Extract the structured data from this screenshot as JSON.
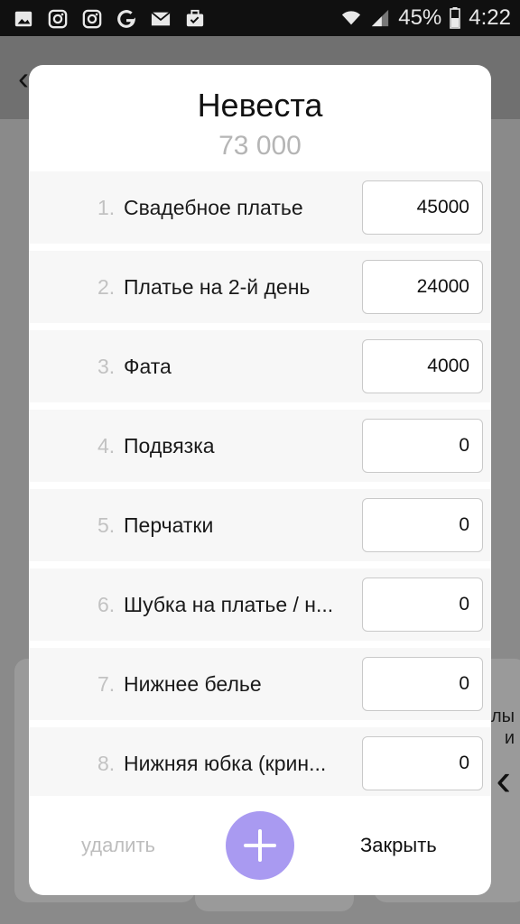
{
  "status_bar": {
    "icons_left": [
      "gallery-icon",
      "instagram-icon",
      "instagram-icon",
      "google-icon",
      "mail-icon",
      "briefcase-check-icon"
    ],
    "battery": "45%",
    "time": "4:22"
  },
  "background": {
    "right_text_line1": "лы",
    "right_text_line2": "и"
  },
  "dialog": {
    "title": "Невеста",
    "total": "73 000",
    "items": [
      {
        "num": "1.",
        "label": "Свадебное платье",
        "value": "45000"
      },
      {
        "num": "2.",
        "label": "Платье на 2-й день",
        "value": "24000"
      },
      {
        "num": "3.",
        "label": "Фата",
        "value": "4000"
      },
      {
        "num": "4.",
        "label": "Подвязка",
        "value": "0"
      },
      {
        "num": "5.",
        "label": "Перчатки",
        "value": "0"
      },
      {
        "num": "6.",
        "label": "Шубка на платье / н...",
        "value": "0"
      },
      {
        "num": "7.",
        "label": "Нижнее белье",
        "value": "0"
      },
      {
        "num": "8.",
        "label": "Нижняя юбка (крин...",
        "value": "0"
      }
    ],
    "delete_label": "удалить",
    "close_label": "Закрыть"
  },
  "colors": {
    "accent": "#a99af1"
  }
}
